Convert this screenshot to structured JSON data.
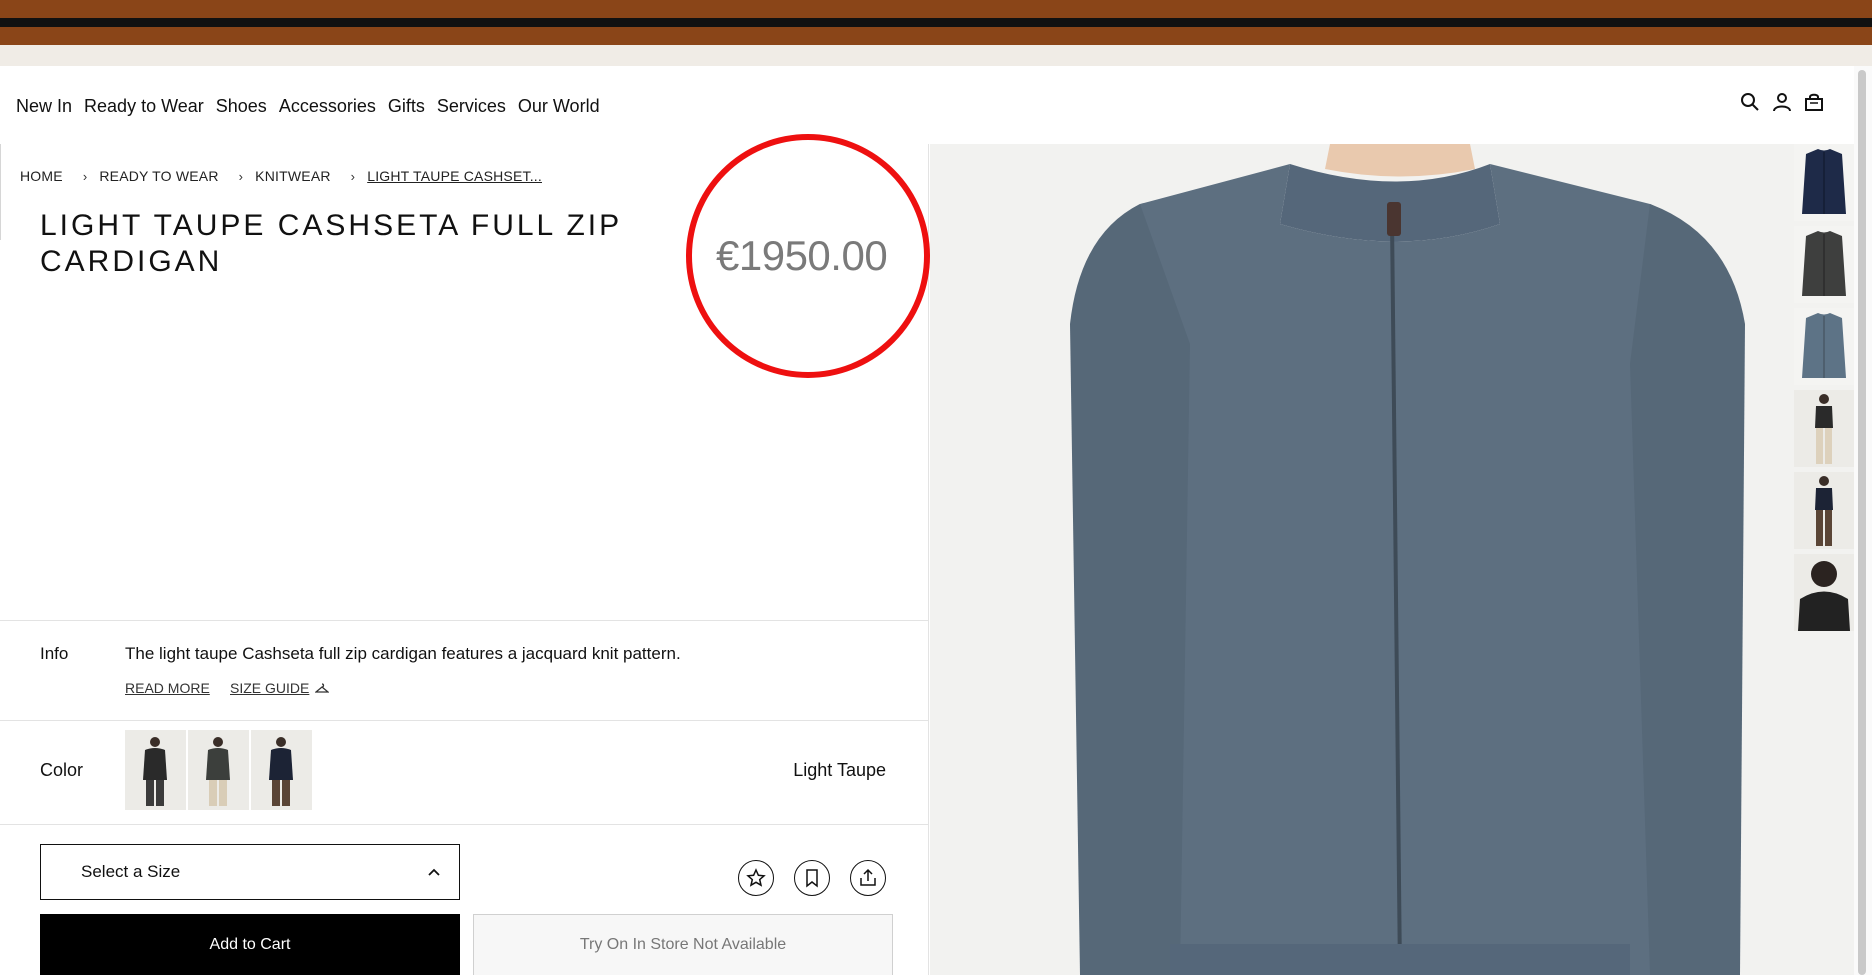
{
  "nav": {
    "items": [
      "New In",
      "Ready to Wear",
      "Shoes",
      "Accessories",
      "Gifts",
      "Services",
      "Our World"
    ]
  },
  "header_icons": [
    "search-icon",
    "account-icon",
    "bag-icon"
  ],
  "breadcrumb": [
    "HOME",
    "READY TO WEAR",
    "KNITWEAR",
    "LIGHT TAUPE CASHSET..."
  ],
  "product": {
    "title": "LIGHT TAUPE CASHSETA FULL ZIP CARDIGAN",
    "price": "€1950.00",
    "info_label": "Info",
    "info_text": "The light taupe Cashseta full zip cardigan features a jacquard knit pattern.",
    "read_more": "READ MORE",
    "size_guide": "SIZE GUIDE",
    "color_label": "Color",
    "color_value": "Light Taupe",
    "size_placeholder": "Select a Size",
    "add_to_cart": "Add to Cart",
    "try_on": "Try On In Store Not Available"
  },
  "colors": {
    "stripe_brown": "#8a4518",
    "stripe_black": "#111111",
    "cardigan": "#5d6f80",
    "highlight_circle": "#ee1010",
    "price_text": "#7a7a7a"
  }
}
